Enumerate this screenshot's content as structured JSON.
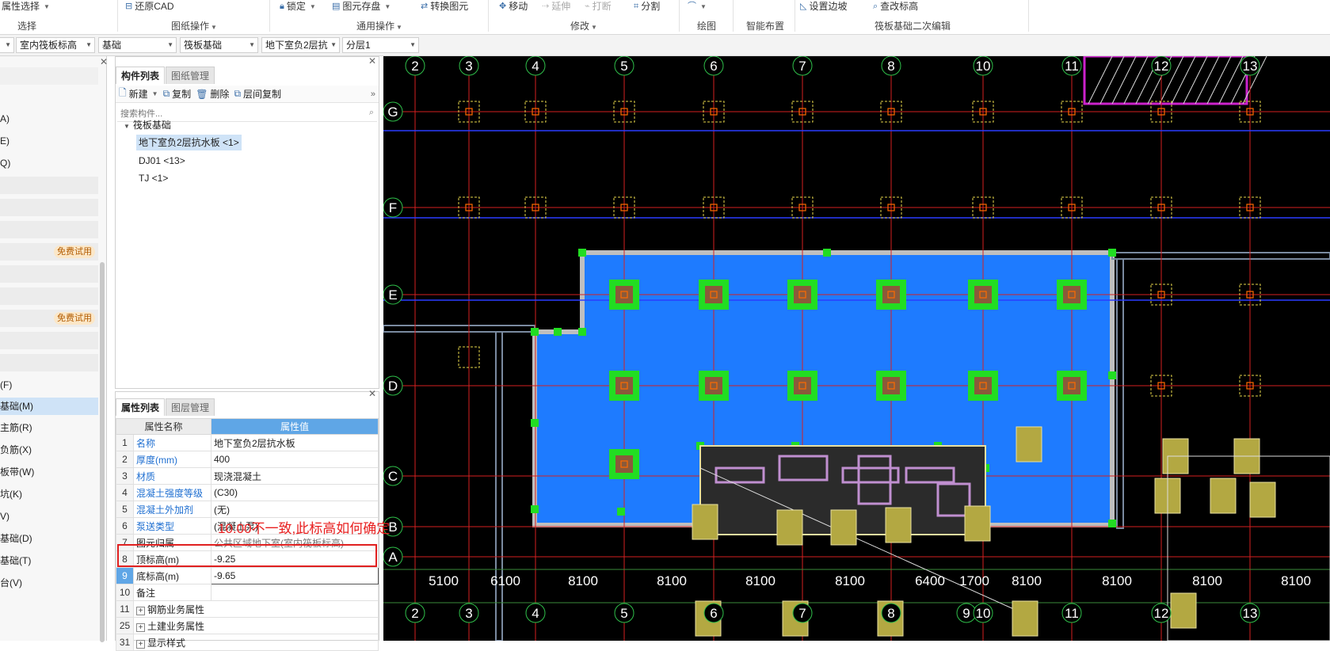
{
  "ribbon": {
    "buttons": [
      {
        "label": "属性选择",
        "icon": "caret-down-icon"
      },
      {
        "label": "还原CAD",
        "icon": "restore-icon"
      },
      {
        "label": "锁定",
        "icon": "lock-icon"
      },
      {
        "label": "图元存盘",
        "icon": "save-icon"
      },
      {
        "label": "转换图元",
        "icon": "convert-icon"
      },
      {
        "label": "移动",
        "icon": "move-icon"
      },
      {
        "label": "延伸",
        "icon": "extend-icon"
      },
      {
        "label": "打断",
        "icon": "break-icon"
      },
      {
        "label": "分割",
        "icon": "split-icon"
      },
      {
        "label": "设置边坡",
        "icon": "slope-icon"
      },
      {
        "label": "查改标高",
        "icon": "elevation-icon"
      }
    ],
    "groups": [
      "选择",
      "图纸操作",
      "通用操作",
      "修改",
      "绘图",
      "智能布置",
      "筏板基础二次编辑"
    ]
  },
  "selectors": {
    "floor": "室内筏板标高",
    "category": "基础",
    "type": "筏板基础",
    "component": "地下室负2层抗",
    "layer": "分层1"
  },
  "nav": {
    "items": [
      "A)",
      "E)",
      "Q)",
      "免费试用",
      "免费试用",
      "(F)",
      "基础(M)",
      "主筋(R)",
      "负筋(X)",
      "板带(W)",
      "坑(K)",
      "V)",
      "基础(D)",
      "基础(T)",
      "台(V)"
    ]
  },
  "component_panel": {
    "tabs": [
      "构件列表",
      "图纸管理"
    ],
    "toolbar": {
      "new": "新建",
      "copy": "复制",
      "delete": "删除",
      "layer_copy": "层间复制"
    },
    "search_placeholder": "搜索构件...",
    "tree": {
      "root": "筏板基础",
      "items": [
        "地下室负2层抗水板 <1>",
        "DJ01 <13>",
        "TJ <1>"
      ]
    }
  },
  "property_panel": {
    "tabs": [
      "属性列表",
      "图层管理"
    ],
    "headers": [
      "属性名称",
      "属性值"
    ],
    "rows": [
      {
        "no": "1",
        "name": "名称",
        "value": "地下室负2层抗水板"
      },
      {
        "no": "2",
        "name": "厚度(mm)",
        "value": "400"
      },
      {
        "no": "3",
        "name": "材质",
        "value": "现浇混凝土"
      },
      {
        "no": "4",
        "name": "混凝土强度等级",
        "value": "(C30)"
      },
      {
        "no": "5",
        "name": "混凝土外加剂",
        "value": "(无)"
      },
      {
        "no": "6",
        "name": "泵送类型",
        "value": "(混凝土泵)"
      },
      {
        "no": "7",
        "name": "图元归属",
        "value": "公共区域地下室(室内筏板标高)"
      },
      {
        "no": "8",
        "name": "顶标高(m)",
        "value": "-9.25"
      },
      {
        "no": "9",
        "name": "底标高(m)",
        "value": "-9.65"
      },
      {
        "no": "10",
        "name": "备注",
        "value": ""
      },
      {
        "no": "11",
        "name": "钢筋业务属性",
        "value": ""
      },
      {
        "no": "25",
        "name": "土建业务属性",
        "value": ""
      },
      {
        "no": "31",
        "name": "显示样式",
        "value": ""
      }
    ]
  },
  "annotation": "10.00不一致,此标高如何确定",
  "cad": {
    "top_axes": [
      "2",
      "3",
      "4",
      "5",
      "6",
      "7",
      "8",
      "10",
      "11",
      "12",
      "13"
    ],
    "bottom_axes": [
      "2",
      "3",
      "4",
      "5",
      "6",
      "7",
      "8",
      "9",
      "10",
      "11",
      "12",
      "13"
    ],
    "row_axes": [
      "G",
      "F",
      "E",
      "D",
      "C",
      "B",
      "A"
    ],
    "dimensions": [
      "5100",
      "6100",
      "8100",
      "8100",
      "8100",
      "8100",
      "6400",
      "1700",
      "8100",
      "8100",
      "8100",
      "8100"
    ],
    "colors": {
      "background": "#000000",
      "raft": "#1e7bff",
      "footing": "#22dd22",
      "grid": "#d42020",
      "wall": "#e8e0a0"
    }
  }
}
